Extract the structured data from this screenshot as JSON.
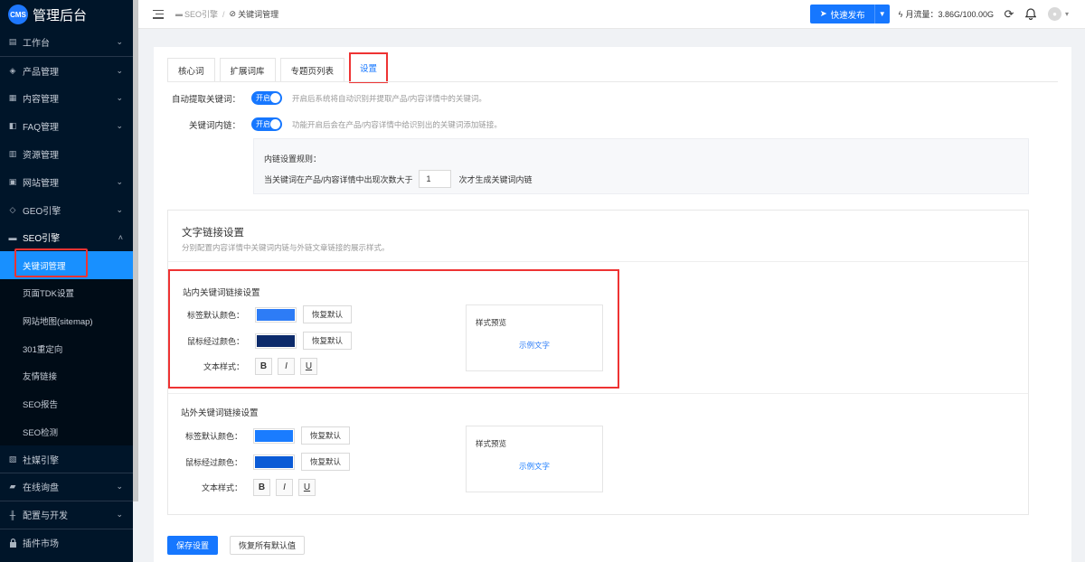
{
  "brand": {
    "logo": "CMS",
    "title": "管理后台"
  },
  "sidebar": {
    "items": [
      {
        "label": "工作台",
        "icon": "dashboard-icon",
        "glyph": "▤",
        "arrow": "⌄"
      },
      {
        "label": "产品管理",
        "icon": "cube-icon",
        "glyph": "◈",
        "arrow": "⌄"
      },
      {
        "label": "内容管理",
        "icon": "document-icon",
        "glyph": "▦",
        "arrow": "⌄"
      },
      {
        "label": "FAQ管理",
        "icon": "faq-icon",
        "glyph": "◧",
        "arrow": "⌄"
      },
      {
        "label": "资源管理",
        "icon": "resource-icon",
        "glyph": "▥",
        "arrow": ""
      },
      {
        "label": "网站管理",
        "icon": "website-icon",
        "glyph": "▣",
        "arrow": "⌄"
      },
      {
        "label": "GEO引擎",
        "icon": "geo-icon",
        "glyph": "◇",
        "arrow": "⌄"
      },
      {
        "label": "SEO引擎",
        "icon": "seo-icon",
        "glyph": "▬",
        "arrow": "˄"
      }
    ],
    "seo_sub": [
      {
        "label": "关键词管理"
      },
      {
        "label": "页面TDK设置"
      },
      {
        "label": "网站地图(sitemap)"
      },
      {
        "label": "301重定向"
      },
      {
        "label": "友情链接"
      },
      {
        "label": "SEO报告"
      },
      {
        "label": "SEO检测"
      }
    ],
    "bottom_items": [
      {
        "label": "社媒引擎",
        "icon": "social-icon",
        "glyph": "▧",
        "arrow": ""
      },
      {
        "label": "在线询盘",
        "icon": "chat-icon",
        "glyph": "▰",
        "arrow": "⌄"
      },
      {
        "label": "配置与开发",
        "icon": "sliders-icon",
        "glyph": "╫",
        "arrow": "⌄"
      },
      {
        "label": "插件市场",
        "icon": "lock-icon",
        "glyph": "🔒",
        "arrow": ""
      }
    ]
  },
  "topbar": {
    "breadcrumb_parent": "SEO引擎",
    "breadcrumb_sep": "/",
    "breadcrumb_current": "关键词管理",
    "quick_publish": "快速发布",
    "traffic": "月流量：3.86G/100.00G"
  },
  "tabs": [
    {
      "label": "核心词"
    },
    {
      "label": "扩展词库"
    },
    {
      "label": "专题页列表"
    },
    {
      "label": "设置"
    }
  ],
  "settings": {
    "auto_extract": {
      "label": "自动提取关键词：",
      "switch": "开启",
      "desc": "开启后系统将自动识别并提取产品/内容详情中的关键词。"
    },
    "inner_link": {
      "label": "关键词内链：",
      "switch": "开启",
      "desc": "功能开启后会在产品/内容详情中给识别出的关键词添加链接。"
    },
    "rule": {
      "title": "内链设置规则：",
      "prefix": "当关键词在产品/内容详情中出现次数大于",
      "value": "1",
      "suffix": "次才生成关键词内链"
    }
  },
  "text_link": {
    "title": "文字链接设置",
    "subtitle": "分别配置内容详情中关键词内链与外链文章链接的展示样式。",
    "internal": {
      "title": "站内关键词链接设置",
      "default_color_label": "标签默认颜色：",
      "default_color": "#2d7cf6",
      "hover_color_label": "鼠标经过颜色：",
      "hover_color": "#0d2b6b",
      "reset": "恢复默认",
      "style_label": "文本样式：",
      "bold": "B",
      "italic": "I",
      "underline": "U",
      "preview_title": "样式预览",
      "preview_text": "示例文字",
      "preview_color": "#2d7cf6"
    },
    "external": {
      "title": "站外关键词链接设置",
      "default_color_label": "标签默认颜色：",
      "default_color": "#1a7cff",
      "hover_color_label": "鼠标经过颜色：",
      "hover_color": "#0b5bd6",
      "reset": "恢复默认",
      "style_label": "文本样式：",
      "bold": "B",
      "italic": "I",
      "underline": "U",
      "preview_title": "样式预览",
      "preview_text": "示例文字",
      "preview_color": "#1a7cff"
    }
  },
  "actions": {
    "save": "保存设置",
    "restore_all": "恢复所有默认值"
  }
}
